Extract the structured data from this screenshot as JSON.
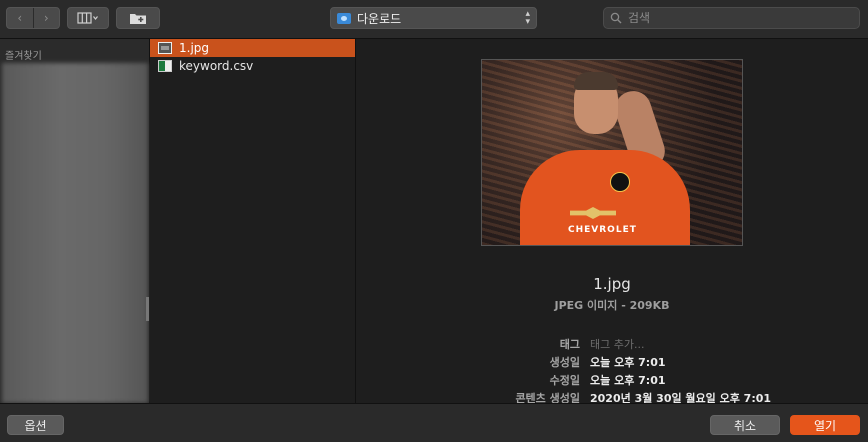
{
  "toolbar": {
    "view_icon": "columns-icon",
    "newfolder_icon": "new-folder-icon",
    "location": "다운로드",
    "search_placeholder": "검색"
  },
  "sidebar": {
    "header": "즐겨찾기"
  },
  "files": [
    {
      "name": "1.jpg",
      "icon": "jpg-icon",
      "selected": true
    },
    {
      "name": "keyword.csv",
      "icon": "csv-icon",
      "selected": false
    }
  ],
  "preview": {
    "image_text": "CHEVROLET",
    "filename": "1.jpg",
    "kind": "JPEG 이미지 - 209KB",
    "meta": [
      {
        "label": "태그",
        "value": "태그 추가...",
        "placeholder": true
      },
      {
        "label": "생성일",
        "value": "오늘 오후 7:01"
      },
      {
        "label": "수정일",
        "value": "오늘 오후 7:01"
      },
      {
        "label": "콘텐츠 생성일",
        "value": "2020년 3월 30일 월요일 오후 7:01"
      }
    ]
  },
  "buttons": {
    "options": "옵션",
    "cancel": "취소",
    "open": "열기"
  },
  "colors": {
    "accent": "#e5551b",
    "selection": "#c9521c"
  }
}
